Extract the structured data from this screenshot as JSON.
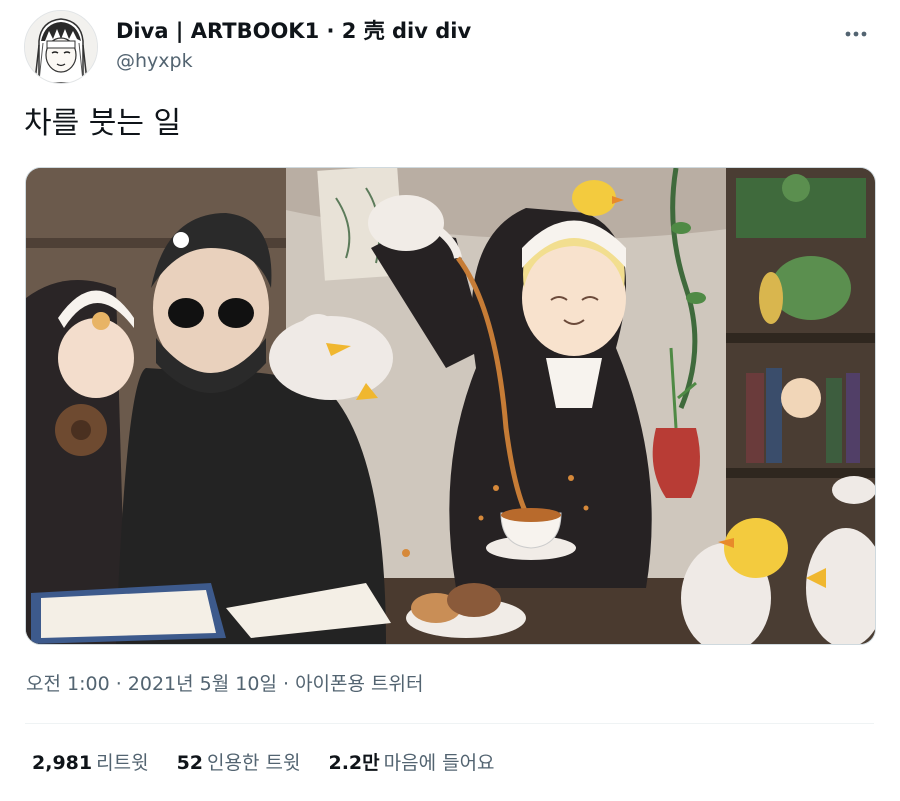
{
  "author": {
    "display_name": "Diva | ARTBOOK1 · 2 壳 div div",
    "handle": "@hyxpk"
  },
  "more_icon": "more-horizontal-icon",
  "tweet": {
    "text": "차를 붓는 일"
  },
  "media": {
    "kind": "illustration"
  },
  "meta": {
    "time": "오전 1:00",
    "date": "2021년 5월 10일",
    "source": "아이폰용 트위터",
    "separator": " · "
  },
  "stats": {
    "retweets_count": "2,981",
    "retweets_label": "리트윗",
    "quotes_count": "52",
    "quotes_label": "인용한 트윗",
    "likes_count": "2.2만",
    "likes_label": "마음에 들어요"
  },
  "colors": {
    "text_primary": "#0f1419",
    "text_secondary": "#536471",
    "border": "#eff3f4"
  }
}
